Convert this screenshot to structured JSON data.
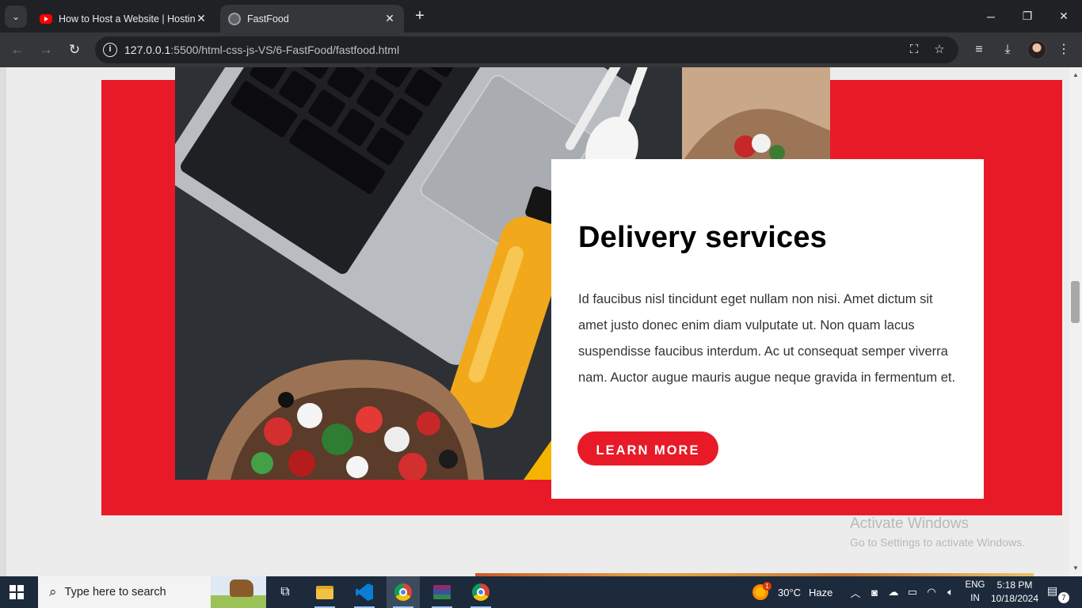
{
  "browser": {
    "tabs": [
      {
        "label": "How to Host a Website | Hosting",
        "favicon": "youtube-icon",
        "active": false
      },
      {
        "label": "FastFood",
        "favicon": "globe-icon",
        "active": true
      }
    ],
    "url": {
      "host": "127.0.0.1",
      "path": ":5500/html-css-js-VS/6-FastFood/fastfood.html"
    },
    "window_controls": {
      "minimize": "─",
      "restore": "❐",
      "close": "✕"
    }
  },
  "page": {
    "section": {
      "heading": "Delivery services",
      "body": "Id faucibus nisl tincidunt eget nullam non nisi. Amet dictum sit amet justo donec enim diam vulputate ut. Non quam lacus suspendisse faucibus interdum. Ac ut consequat semper viverra nam. Auctor augue mauris augue neque gravida in fermentum et.",
      "button_label": "LEARN MORE",
      "accent_color": "#e81a28"
    },
    "watermark": {
      "title": "Activate Windows",
      "subtitle": "Go to Settings to activate Windows."
    }
  },
  "taskbar": {
    "search_placeholder": "Type here to search",
    "apps": [
      "task-view-icon",
      "file-explorer-icon",
      "vscode-icon",
      "chrome-icon",
      "winrar-icon",
      "chrome-icon"
    ],
    "weather": {
      "temp": "30°C",
      "condition": "Haze",
      "alert_count": "1"
    },
    "language": {
      "line1": "ENG",
      "line2": "IN"
    },
    "clock": {
      "time": "5:18 PM",
      "date": "10/18/2024"
    },
    "notification_count": "7"
  }
}
